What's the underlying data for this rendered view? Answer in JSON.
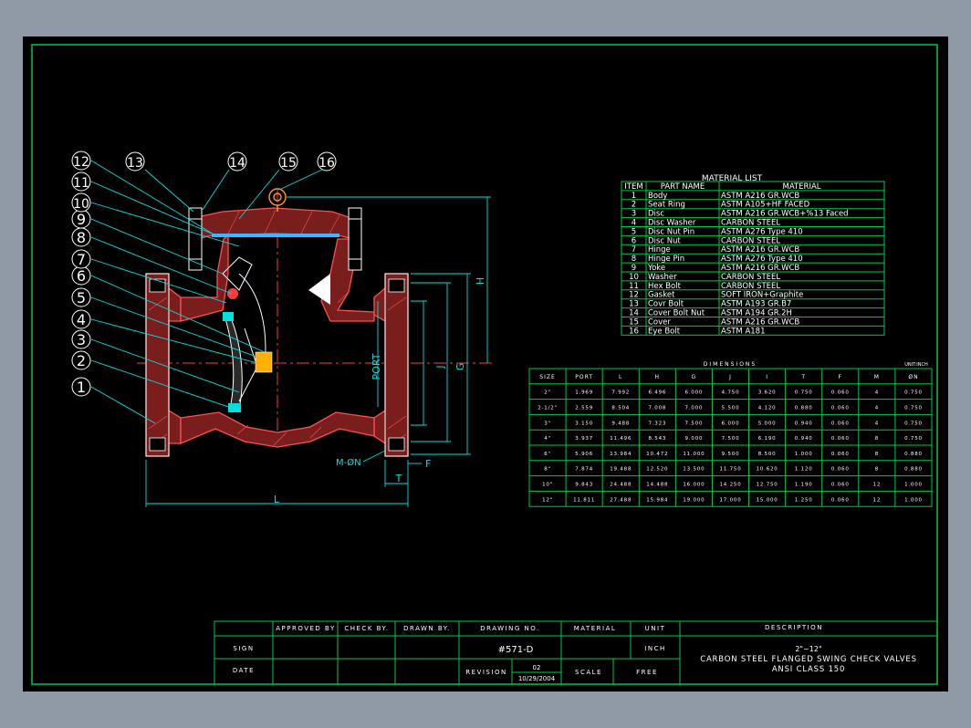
{
  "material_list": {
    "title": "MATERIAL LIST",
    "headers": [
      "ITEM",
      "PART NAME",
      "MATERIAL"
    ],
    "rows": [
      [
        "1",
        "Body",
        "ASTM A216 GR.WCB"
      ],
      [
        "2",
        "Seat Ring",
        "ASTM A105+HF FACED"
      ],
      [
        "3",
        "Disc",
        "ASTM A216 GR.WCB+%13 Faced"
      ],
      [
        "4",
        "Disc Washer",
        "CARBON STEEL"
      ],
      [
        "5",
        "Disc Nut Pin",
        "ASTM A276 Type 410"
      ],
      [
        "6",
        "Disc Nut",
        "CARBON STEEL"
      ],
      [
        "7",
        "Hinge",
        "ASTM A216 GR.WCB"
      ],
      [
        "8",
        "Hinge Pin",
        "ASTM A276 Type 410"
      ],
      [
        "9",
        "Yoke",
        "ASTM A216 GR.WCB"
      ],
      [
        "10",
        "Washer",
        "CARBON STEEL"
      ],
      [
        "11",
        "Hex Bolt",
        "CARBON STEEL"
      ],
      [
        "12",
        "Gasket",
        "SOFT IRON+Graphite"
      ],
      [
        "13",
        "Covr Bolt",
        "ASTM A193 GR.B7"
      ],
      [
        "14",
        "Cover Bolt Nut",
        "ASTM A194 GR.2H"
      ],
      [
        "15",
        "Cover",
        "ASTM A216 GR.WCB"
      ],
      [
        "16",
        "Eye Bolt",
        "ASTM A181"
      ]
    ]
  },
  "dimensions": {
    "title": "DIMENSIONS",
    "unit_note": "UNIT:INCH",
    "headers": [
      "SIZE",
      "PORT",
      "L",
      "H",
      "G",
      "J",
      "I",
      "T",
      "F",
      "M",
      "ØN"
    ],
    "rows": [
      [
        "2\"",
        "1.969",
        "7.992",
        "6.496",
        "6.000",
        "4.750",
        "3.620",
        "0.750",
        "0.060",
        "4",
        "0.750"
      ],
      [
        "2-1/2\"",
        "2.559",
        "8.504",
        "7.008",
        "7.000",
        "5.500",
        "4.120",
        "0.880",
        "0.060",
        "4",
        "0.750"
      ],
      [
        "3\"",
        "3.150",
        "9.488",
        "7.323",
        "7.500",
        "6.000",
        "5.000",
        "0.940",
        "0.060",
        "4",
        "0.750"
      ],
      [
        "4\"",
        "3.937",
        "11.496",
        "8.543",
        "9.000",
        "7.500",
        "6.190",
        "0.940",
        "0.060",
        "8",
        "0.750"
      ],
      [
        "6\"",
        "5.906",
        "13.984",
        "10.472",
        "11.000",
        "9.500",
        "8.500",
        "1.000",
        "0.060",
        "8",
        "0.880"
      ],
      [
        "8\"",
        "7.874",
        "19.488",
        "12.520",
        "13.500",
        "11.750",
        "10.620",
        "1.120",
        "0.060",
        "8",
        "0.880"
      ],
      [
        "10\"",
        "9.843",
        "24.488",
        "14.488",
        "16.000",
        "14.250",
        "12.750",
        "1.190",
        "0.060",
        "12",
        "1.000"
      ],
      [
        "12\"",
        "11.811",
        "27.488",
        "15.984",
        "19.000",
        "17.000",
        "15.000",
        "1.250",
        "0.060",
        "12",
        "1.000"
      ]
    ]
  },
  "drawing": {
    "callouts": [
      "1",
      "2",
      "3",
      "4",
      "5",
      "6",
      "7",
      "8",
      "9",
      "10",
      "11",
      "12",
      "13",
      "14",
      "15",
      "16"
    ],
    "dim_labels": {
      "port": "PORT",
      "j": "J",
      "g": "G",
      "h": "H",
      "l": "L",
      "t": "T",
      "f": "F",
      "mn": "M-ØN"
    }
  },
  "title_block": {
    "approved_by": "APPROVED BY",
    "check_by": "CHECK BY.",
    "drawn_by": "DRAWN BY.",
    "drawing_no_label": "DRAWING NO.",
    "drawing_no": "#571-D",
    "material_label": "MATERIAL",
    "unit_label": "UNIT",
    "unit_value": "INCH",
    "description_label": "DESCRIPTION",
    "sign": "SIGN",
    "date": "DATE",
    "revision_label": "REVISION",
    "revision_no": "02",
    "revision_date": "10/29/2004",
    "scale_label": "SCALE",
    "scale_value": "FREE",
    "desc_line1": "2\"~12\"",
    "desc_line2": "CARBON STEEL FLANGED SWING CHECK VALVES",
    "desc_line3": "ANSI CLASS 150"
  },
  "colors": {
    "background": "#000000",
    "frame": "#00c84a",
    "body": "#ff4d4d",
    "dims": "#00e0e0",
    "text": "#ffffff",
    "outer": "#8f9aa6"
  }
}
